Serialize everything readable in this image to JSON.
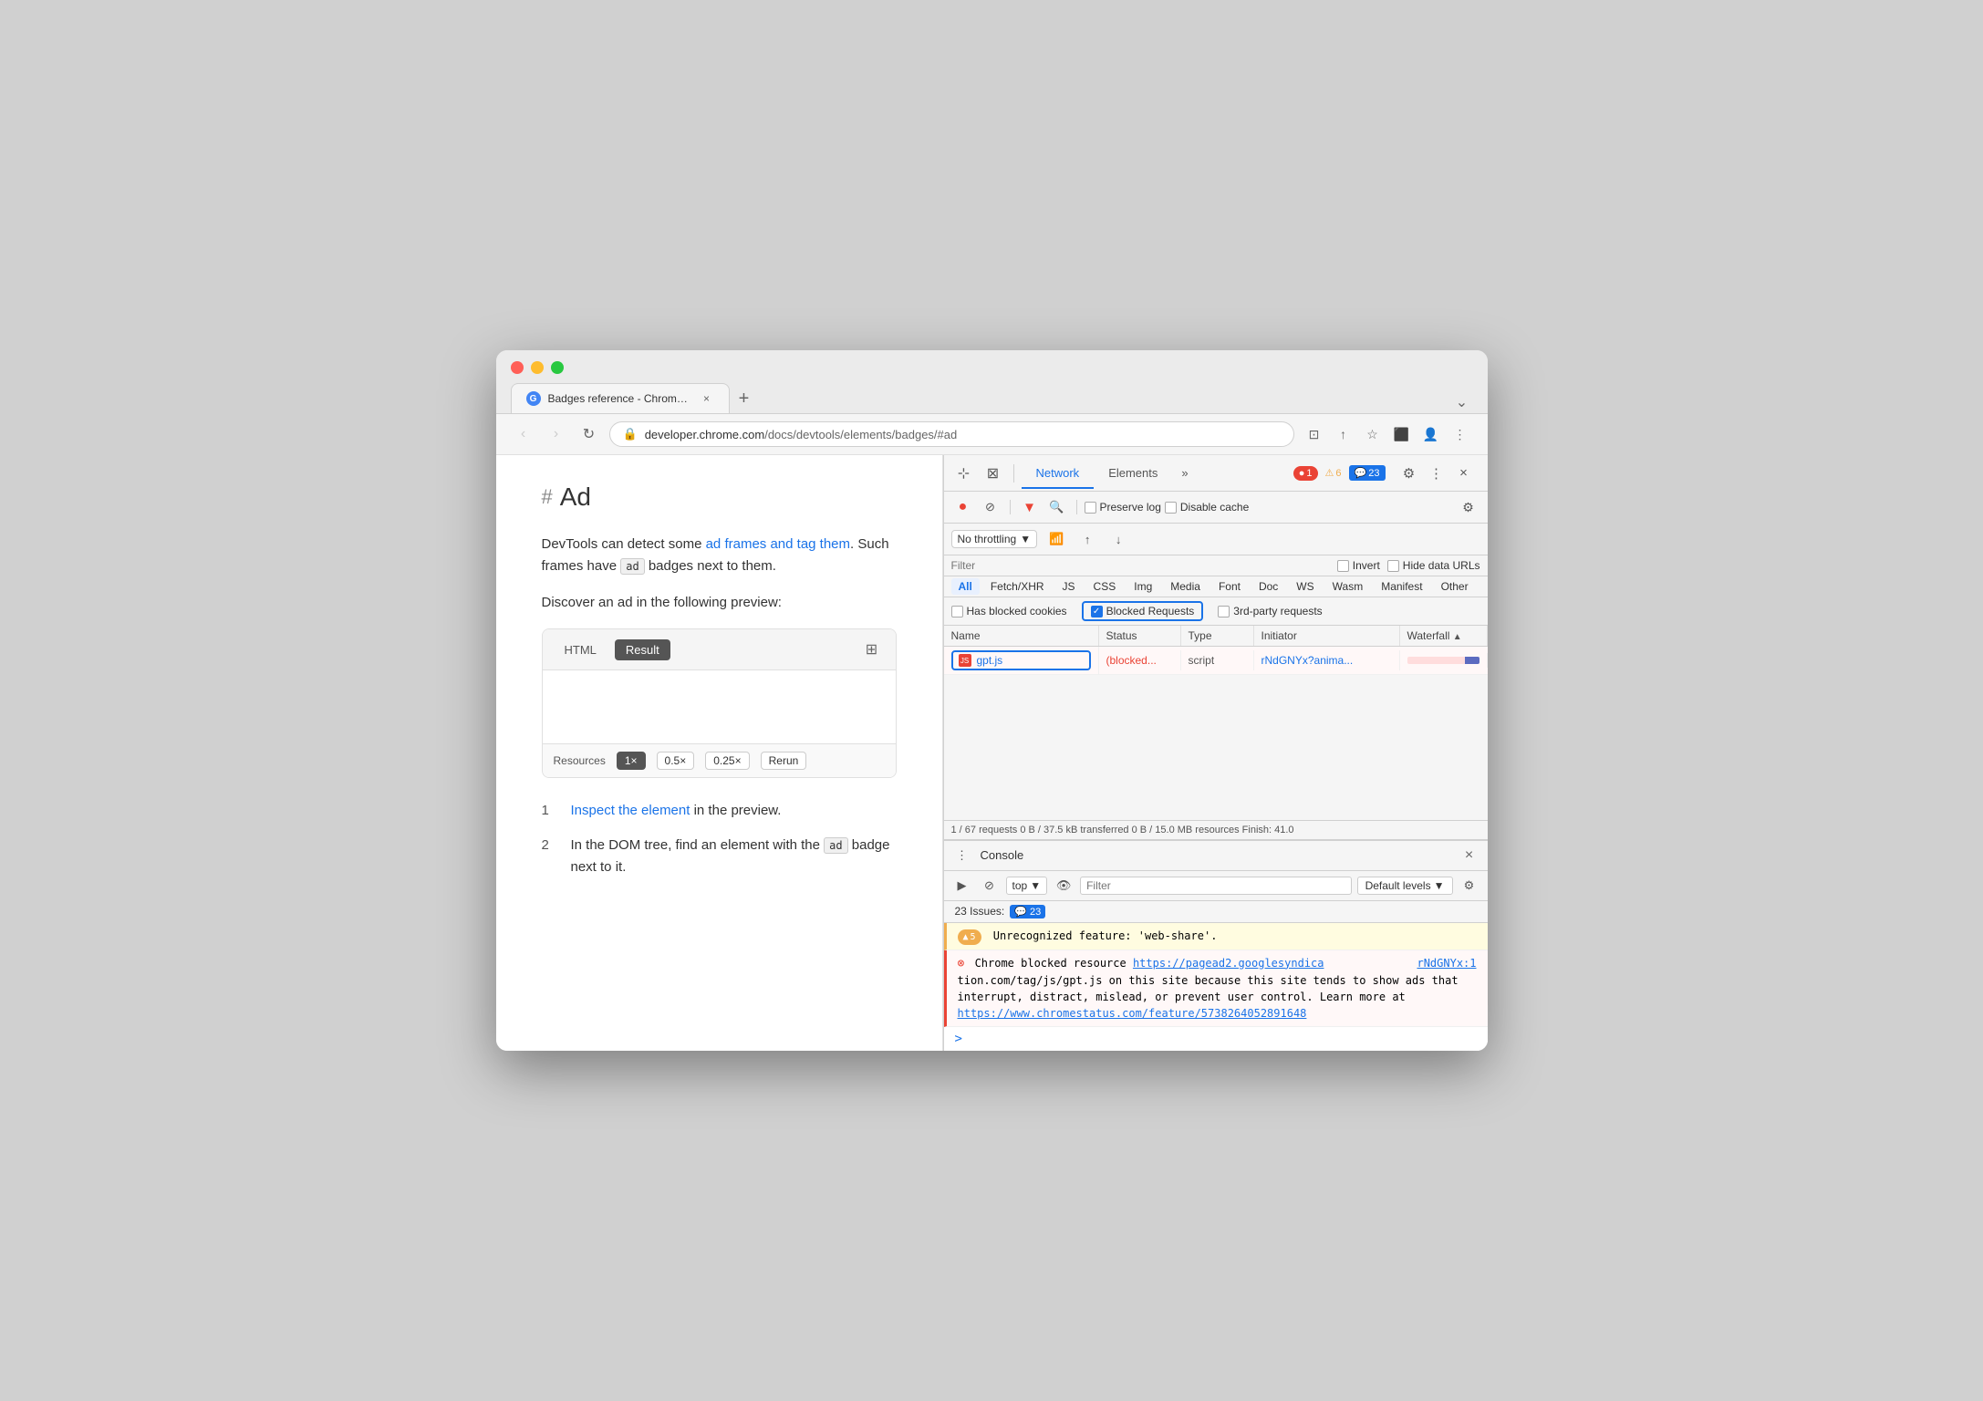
{
  "browser": {
    "tab": {
      "favicon_text": "G",
      "title": "Badges reference - Chrome De",
      "close": "×",
      "new_tab": "+"
    },
    "nav": {
      "back": "‹",
      "forward": "›",
      "reload": "↻",
      "url_lock": "🔒",
      "url": "developer.chrome.com/docs/devtools/elements/badges/#ad",
      "url_host": "developer.chrome.com",
      "url_path": "/docs/devtools/elements/badges/#ad"
    },
    "address_icons": [
      "⊡",
      "↑",
      "☆",
      "★",
      "⊤",
      "⬜",
      "👤",
      "⋮"
    ]
  },
  "page": {
    "heading_hash": "#",
    "heading": "Ad",
    "intro_text": "DevTools can detect some ",
    "intro_link1": "ad frames and tag them",
    "intro_mid": ". Such frames have ",
    "intro_badge": "ad",
    "intro_end": " badges next to them.",
    "discover_text": "Discover an ad in the following preview:",
    "code_tabs": [
      "HTML",
      "Result"
    ],
    "active_code_tab": "Result",
    "resources_label": "Resources",
    "resources_options": [
      "1×",
      "0.5×",
      "0.25×",
      "Rerun"
    ],
    "active_resource": "1×",
    "steps": [
      {
        "num": "1",
        "pre": "",
        "link": "Inspect the element",
        "post": " in the preview."
      },
      {
        "num": "2",
        "pre": "In the DOM tree, find an element with the ",
        "badge": "ad",
        "post": " badge next to it."
      }
    ]
  },
  "devtools": {
    "toolbar_icons": [
      "⊹",
      "⊠"
    ],
    "tabs": [
      "Network",
      "Elements"
    ],
    "active_tab": "Network",
    "more_tabs": "»",
    "badges": {
      "errors": "1",
      "warnings": "6",
      "info": "23"
    },
    "icons": [
      "⚙",
      "⋮",
      "×"
    ],
    "network": {
      "record_btn": "●",
      "block_btn": "⊘",
      "filter_icon": "▼",
      "search_icon": "🔍",
      "preserve_log": "Preserve log",
      "disable_cache": "Disable cache",
      "gear_icon": "⚙",
      "throttle_label": "No throttling",
      "wifi_icon": "📶",
      "upload_icon": "↑",
      "download_icon": "↓",
      "filter_placeholder": "Filter",
      "invert_label": "Invert",
      "hide_data_urls_label": "Hide data URLs",
      "type_filters": [
        "All",
        "Fetch/XHR",
        "JS",
        "CSS",
        "Img",
        "Media",
        "Font",
        "Doc",
        "WS",
        "Wasm",
        "Manifest",
        "Other"
      ],
      "active_type": "All",
      "has_blocked_cookies_label": "Has blocked cookies",
      "blocked_requests_label": "Blocked Requests",
      "third_party_label": "3rd-party requests",
      "columns": [
        "Name",
        "Status",
        "Type",
        "Initiator",
        "Waterfall"
      ],
      "rows": [
        {
          "name": "gpt.js",
          "status": "(blocked...",
          "type": "script",
          "initiator": "rNdGNYx?anima...",
          "has_waterfall": true
        }
      ],
      "summary": "1 / 67 requests   0 B / 37.5 kB transferred   0 B / 15.0 MB resources   Finish: 41.0"
    },
    "console": {
      "title": "Console",
      "close": "×",
      "play_icon": "▶",
      "block_icon": "⊘",
      "top_label": "top",
      "eye_icon": "👁",
      "filter_placeholder": "Filter",
      "default_levels_label": "Default levels",
      "gear_icon": "⚙",
      "issues_label": "23 Issues:",
      "issues_count": "23",
      "messages": [
        {
          "type": "warning",
          "badge_count": "5",
          "text": "Unrecognized feature: 'web-share'."
        },
        {
          "type": "error",
          "pre_text": "Chrome blocked resource ",
          "link1": "https://pagead2.googlesyndica",
          "link2": "rNdGNYx:1",
          "mid_text": "tion.com/tag/js/gpt.js",
          "post_text": " on this site because this site tends to show ads that interrupt, distract, mislead, or prevent user control. Learn more at ",
          "link3": "https://www.chromestatus.com/feature/5738264052891648"
        }
      ],
      "prompt_arrow": ">"
    }
  }
}
